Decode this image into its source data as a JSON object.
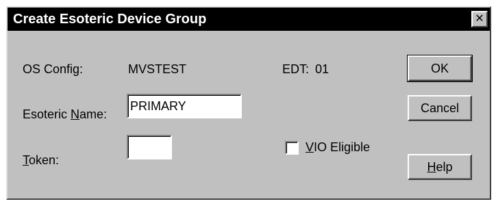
{
  "dialog": {
    "title": "Create Esoteric Device Group",
    "close_glyph": "✕"
  },
  "os_config": {
    "label": "OS Config:",
    "value": "MVSTEST"
  },
  "edt": {
    "label": "EDT:",
    "value": "01"
  },
  "esoteric_name": {
    "label_pre": "Esoteric ",
    "label_mnemonic": "N",
    "label_post": "ame:",
    "value": "PRIMARY"
  },
  "token": {
    "label_mnemonic": "T",
    "label_post": "oken:",
    "value": ""
  },
  "vio": {
    "label_mnemonic": "V",
    "label_post": "IO Eligible",
    "checked": false
  },
  "buttons": {
    "ok": "OK",
    "cancel": "Cancel",
    "help_mnemonic": "H",
    "help_post": "elp"
  }
}
